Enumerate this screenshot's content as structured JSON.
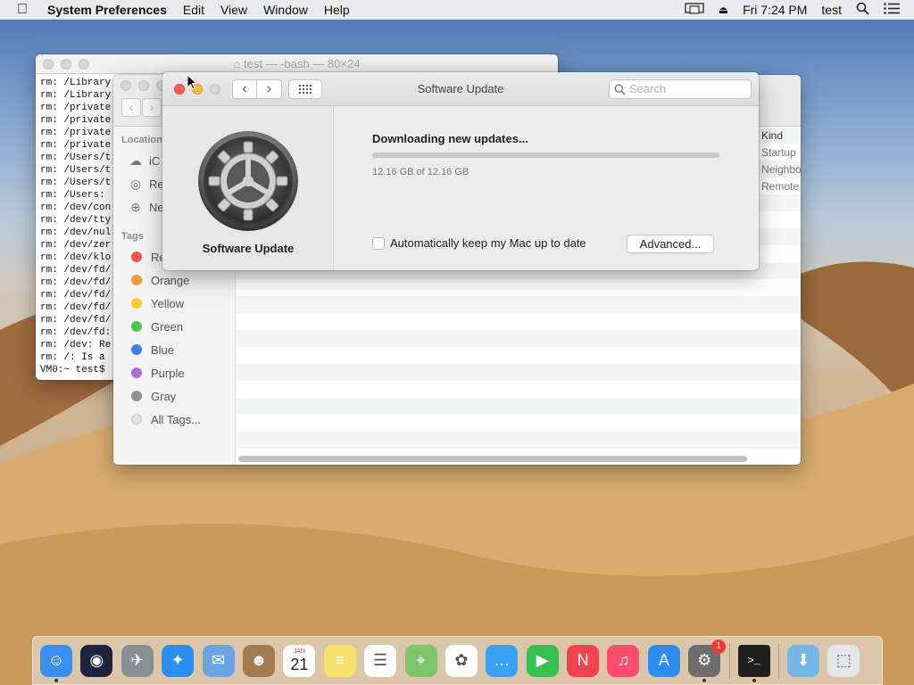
{
  "menubar": {
    "app_name": "System Preferences",
    "menus": [
      "Edit",
      "View",
      "Window",
      "Help"
    ],
    "clock": "Fri 7:24 PM",
    "user": "test"
  },
  "terminal": {
    "title": "test — -bash — 80×24",
    "lines": [
      "rm: /Library",
      "rm: /Library",
      "rm: /private",
      "rm: /private",
      "rm: /private",
      "rm: /private",
      "rm: /Users/t",
      "rm: /Users/t",
      "rm: /Users/t",
      "rm: /Users:",
      "rm: /dev/con",
      "rm: /dev/tty",
      "rm: /dev/nul",
      "rm: /dev/zer",
      "rm: /dev/klo",
      "rm: /dev/fd/",
      "rm: /dev/fd/",
      "rm: /dev/fd/",
      "rm: /dev/fd/",
      "rm: /dev/fd/",
      "rm: /dev/fd:",
      "rm: /dev: Re",
      "rm: /: Is a",
      "VM0:~ test$"
    ]
  },
  "finder": {
    "locations_header": "Location",
    "locations": [
      {
        "label": "iC",
        "icon": "cloud-icon"
      },
      {
        "label": "Re",
        "icon": "disc-icon"
      },
      {
        "label": "Ne",
        "icon": "globe-icon"
      }
    ],
    "tags_header": "Tags",
    "tags": [
      {
        "label": "Re",
        "color": "#f2564f"
      },
      {
        "label": "Orange",
        "color": "#f59b35"
      },
      {
        "label": "Yellow",
        "color": "#f5cd30"
      },
      {
        "label": "Green",
        "color": "#53c548"
      },
      {
        "label": "Blue",
        "color": "#3d7ff6"
      },
      {
        "label": "Purple",
        "color": "#b56ad6"
      },
      {
        "label": "Gray",
        "color": "#939393"
      },
      {
        "label": "All Tags...",
        "color": "#e2e2e2"
      }
    ],
    "kind_header": "Kind",
    "kind_cells": [
      "Startup",
      "Neighbo",
      "Remote"
    ]
  },
  "software_update": {
    "title": "Software Update",
    "search_placeholder": "Search",
    "pane_label": "Software Update",
    "status": "Downloading new updates...",
    "progress_fraction": 1.0,
    "size_text": "12.16 GB of 12.16 GB",
    "auto_label": "Automatically keep my Mac up to date",
    "advanced_label": "Advanced...",
    "badge_count": "1"
  },
  "dock": {
    "apps": [
      {
        "name": "finder-icon",
        "bg": "#3a8ff0",
        "running": true
      },
      {
        "name": "siri-icon",
        "bg": "#1f2340",
        "running": false
      },
      {
        "name": "launchpad-icon",
        "bg": "#8a8f96",
        "running": false
      },
      {
        "name": "safari-icon",
        "bg": "#2b8ef0",
        "running": false
      },
      {
        "name": "mail-icon",
        "bg": "#6aa4e6",
        "running": false
      },
      {
        "name": "contacts-icon",
        "bg": "#a27c50",
        "running": false
      },
      {
        "name": "calendar-icon",
        "bg": "#ffffff",
        "running": false
      },
      {
        "name": "notes-icon",
        "bg": "#f7e06a",
        "running": false
      },
      {
        "name": "reminders-icon",
        "bg": "#ffffff",
        "running": false
      },
      {
        "name": "maps-icon",
        "bg": "#7fc46a",
        "running": false
      },
      {
        "name": "photos-icon",
        "bg": "#ffffff",
        "running": false
      },
      {
        "name": "messages-icon",
        "bg": "#3aa0f5",
        "running": false
      },
      {
        "name": "facetime-icon",
        "bg": "#35c152",
        "running": false
      },
      {
        "name": "news-icon",
        "bg": "#f2434e",
        "running": false
      },
      {
        "name": "music-icon",
        "bg": "#fc4c6e",
        "running": false
      },
      {
        "name": "app-store-icon",
        "bg": "#2e8df2",
        "running": false
      },
      {
        "name": "system-preferences-icon",
        "bg": "#6e6e6e",
        "running": true
      },
      {
        "name": "terminal-icon",
        "bg": "#1f1f1f",
        "running": true
      },
      {
        "name": "downloads-folder-icon",
        "bg": "#74b8e8",
        "running": false
      },
      {
        "name": "trash-icon",
        "bg": "#e3e7ea",
        "running": false
      }
    ],
    "calendar_month": "JAN",
    "calendar_day": "21"
  }
}
